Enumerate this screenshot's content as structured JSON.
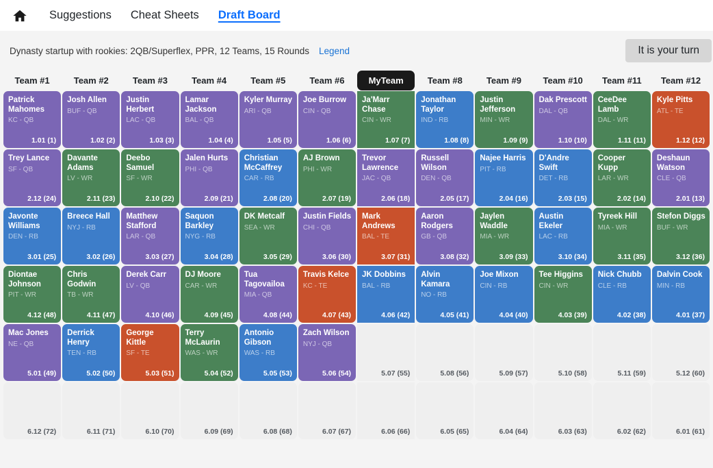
{
  "nav": {
    "home_icon": "home-icon",
    "items": [
      {
        "label": "Suggestions",
        "active": false
      },
      {
        "label": "Cheat Sheets",
        "active": false
      },
      {
        "label": "Draft Board",
        "active": true
      }
    ]
  },
  "subheader": {
    "league_description": "Dynasty startup with rookies: 2QB/Superflex, PPR, 12 Teams, 15 Rounds",
    "legend_label": "Legend",
    "turn_badge": "It is your turn"
  },
  "colors": {
    "QB": "#7b66b5",
    "RB": "#3d7dc9",
    "WR": "#4b8458",
    "TE": "#c9512c",
    "empty": "#efefef",
    "myteam_header": "#1a1a1a",
    "accent_link": "#0b6efd"
  },
  "board": {
    "my_team_index": 6,
    "columns": [
      "Team #1",
      "Team #2",
      "Team #3",
      "Team #4",
      "Team #5",
      "Team #6",
      "MyTeam",
      "Team #8",
      "Team #9",
      "Team #10",
      "Team #11",
      "Team #12"
    ],
    "rows": [
      [
        {
          "name": "Patrick Mahomes",
          "meta": "KC - QB",
          "pos": "QB",
          "pick": "1.01 (1)"
        },
        {
          "name": "Josh Allen",
          "meta": "BUF - QB",
          "pos": "QB",
          "pick": "1.02 (2)"
        },
        {
          "name": "Justin Herbert",
          "meta": "LAC - QB",
          "pos": "QB",
          "pick": "1.03 (3)"
        },
        {
          "name": "Lamar Jackson",
          "meta": "BAL - QB",
          "pos": "QB",
          "pick": "1.04 (4)"
        },
        {
          "name": "Kyler Murray",
          "meta": "ARI - QB",
          "pos": "QB",
          "pick": "1.05 (5)"
        },
        {
          "name": "Joe Burrow",
          "meta": "CIN - QB",
          "pos": "QB",
          "pick": "1.06 (6)"
        },
        {
          "name": "Ja'Marr Chase",
          "meta": "CIN - WR",
          "pos": "WR",
          "pick": "1.07 (7)"
        },
        {
          "name": "Jonathan Taylor",
          "meta": "IND - RB",
          "pos": "RB",
          "pick": "1.08 (8)"
        },
        {
          "name": "Justin Jefferson",
          "meta": "MIN - WR",
          "pos": "WR",
          "pick": "1.09 (9)"
        },
        {
          "name": "Dak Prescott",
          "meta": "DAL - QB",
          "pos": "QB",
          "pick": "1.10 (10)"
        },
        {
          "name": "CeeDee Lamb",
          "meta": "DAL - WR",
          "pos": "WR",
          "pick": "1.11 (11)"
        },
        {
          "name": "Kyle Pitts",
          "meta": "ATL - TE",
          "pos": "TE",
          "pick": "1.12 (12)"
        }
      ],
      [
        {
          "name": "Trey Lance",
          "meta": "SF - QB",
          "pos": "QB",
          "pick": "2.12 (24)"
        },
        {
          "name": "Davante Adams",
          "meta": "LV - WR",
          "pos": "WR",
          "pick": "2.11 (23)"
        },
        {
          "name": "Deebo Samuel",
          "meta": "SF - WR",
          "pos": "WR",
          "pick": "2.10 (22)"
        },
        {
          "name": "Jalen Hurts",
          "meta": "PHI - QB",
          "pos": "QB",
          "pick": "2.09 (21)"
        },
        {
          "name": "Christian McCaffrey",
          "meta": "CAR - RB",
          "pos": "RB",
          "pick": "2.08 (20)"
        },
        {
          "name": "AJ Brown",
          "meta": "PHI - WR",
          "pos": "WR",
          "pick": "2.07 (19)"
        },
        {
          "name": "Trevor Lawrence",
          "meta": "JAC - QB",
          "pos": "QB",
          "pick": "2.06 (18)"
        },
        {
          "name": "Russell Wilson",
          "meta": "DEN - QB",
          "pos": "QB",
          "pick": "2.05 (17)"
        },
        {
          "name": "Najee Harris",
          "meta": "PIT - RB",
          "pos": "RB",
          "pick": "2.04 (16)"
        },
        {
          "name": "D'Andre Swift",
          "meta": "DET - RB",
          "pos": "RB",
          "pick": "2.03 (15)"
        },
        {
          "name": "Cooper Kupp",
          "meta": "LAR - WR",
          "pos": "WR",
          "pick": "2.02 (14)"
        },
        {
          "name": "Deshaun Watson",
          "meta": "CLE - QB",
          "pos": "QB",
          "pick": "2.01 (13)"
        }
      ],
      [
        {
          "name": "Javonte Williams",
          "meta": "DEN - RB",
          "pos": "RB",
          "pick": "3.01 (25)"
        },
        {
          "name": "Breece Hall",
          "meta": "NYJ - RB",
          "pos": "RB",
          "pick": "3.02 (26)"
        },
        {
          "name": "Matthew Stafford",
          "meta": "LAR - QB",
          "pos": "QB",
          "pick": "3.03 (27)"
        },
        {
          "name": "Saquon Barkley",
          "meta": "NYG - RB",
          "pos": "RB",
          "pick": "3.04 (28)"
        },
        {
          "name": "DK Metcalf",
          "meta": "SEA - WR",
          "pos": "WR",
          "pick": "3.05 (29)"
        },
        {
          "name": "Justin Fields",
          "meta": "CHI - QB",
          "pos": "QB",
          "pick": "3.06 (30)"
        },
        {
          "name": "Mark Andrews",
          "meta": "BAL - TE",
          "pos": "TE",
          "pick": "3.07 (31)"
        },
        {
          "name": "Aaron Rodgers",
          "meta": "GB - QB",
          "pos": "QB",
          "pick": "3.08 (32)"
        },
        {
          "name": "Jaylen Waddle",
          "meta": "MIA - WR",
          "pos": "WR",
          "pick": "3.09 (33)"
        },
        {
          "name": "Austin Ekeler",
          "meta": "LAC - RB",
          "pos": "RB",
          "pick": "3.10 (34)"
        },
        {
          "name": "Tyreek Hill",
          "meta": "MIA - WR",
          "pos": "WR",
          "pick": "3.11 (35)"
        },
        {
          "name": "Stefon Diggs",
          "meta": "BUF - WR",
          "pos": "WR",
          "pick": "3.12 (36)"
        }
      ],
      [
        {
          "name": "Diontae Johnson",
          "meta": "PIT - WR",
          "pos": "WR",
          "pick": "4.12 (48)"
        },
        {
          "name": "Chris Godwin",
          "meta": "TB - WR",
          "pos": "WR",
          "pick": "4.11 (47)"
        },
        {
          "name": "Derek Carr",
          "meta": "LV - QB",
          "pos": "QB",
          "pick": "4.10 (46)"
        },
        {
          "name": "DJ Moore",
          "meta": "CAR - WR",
          "pos": "WR",
          "pick": "4.09 (45)"
        },
        {
          "name": "Tua Tagovailoa",
          "meta": "MIA - QB",
          "pos": "QB",
          "pick": "4.08 (44)"
        },
        {
          "name": "Travis Kelce",
          "meta": "KC - TE",
          "pos": "TE",
          "pick": "4.07 (43)"
        },
        {
          "name": "JK Dobbins",
          "meta": "BAL - RB",
          "pos": "RB",
          "pick": "4.06 (42)"
        },
        {
          "name": "Alvin Kamara",
          "meta": "NO - RB",
          "pos": "RB",
          "pick": "4.05 (41)"
        },
        {
          "name": "Joe Mixon",
          "meta": "CIN - RB",
          "pos": "RB",
          "pick": "4.04 (40)"
        },
        {
          "name": "Tee Higgins",
          "meta": "CIN - WR",
          "pos": "WR",
          "pick": "4.03 (39)"
        },
        {
          "name": "Nick Chubb",
          "meta": "CLE - RB",
          "pos": "RB",
          "pick": "4.02 (38)"
        },
        {
          "name": "Dalvin Cook",
          "meta": "MIN - RB",
          "pos": "RB",
          "pick": "4.01 (37)"
        }
      ],
      [
        {
          "name": "Mac Jones",
          "meta": "NE - QB",
          "pos": "QB",
          "pick": "5.01 (49)"
        },
        {
          "name": "Derrick Henry",
          "meta": "TEN - RB",
          "pos": "RB",
          "pick": "5.02 (50)"
        },
        {
          "name": "George Kittle",
          "meta": "SF - TE",
          "pos": "TE",
          "pick": "5.03 (51)"
        },
        {
          "name": "Terry McLaurin",
          "meta": "WAS - WR",
          "pos": "WR",
          "pick": "5.04 (52)"
        },
        {
          "name": "Antonio Gibson",
          "meta": "WAS - RB",
          "pos": "RB",
          "pick": "5.05 (53)"
        },
        {
          "name": "Zach Wilson",
          "meta": "NYJ - QB",
          "pos": "QB",
          "pick": "5.06 (54)"
        },
        {
          "name": "",
          "meta": "",
          "pos": "",
          "pick": "5.07 (55)"
        },
        {
          "name": "",
          "meta": "",
          "pos": "",
          "pick": "5.08 (56)"
        },
        {
          "name": "",
          "meta": "",
          "pos": "",
          "pick": "5.09 (57)"
        },
        {
          "name": "",
          "meta": "",
          "pos": "",
          "pick": "5.10 (58)"
        },
        {
          "name": "",
          "meta": "",
          "pos": "",
          "pick": "5.11 (59)"
        },
        {
          "name": "",
          "meta": "",
          "pos": "",
          "pick": "5.12 (60)"
        }
      ],
      [
        {
          "name": "",
          "meta": "",
          "pos": "",
          "pick": "6.12 (72)"
        },
        {
          "name": "",
          "meta": "",
          "pos": "",
          "pick": "6.11 (71)"
        },
        {
          "name": "",
          "meta": "",
          "pos": "",
          "pick": "6.10 (70)"
        },
        {
          "name": "",
          "meta": "",
          "pos": "",
          "pick": "6.09 (69)"
        },
        {
          "name": "",
          "meta": "",
          "pos": "",
          "pick": "6.08 (68)"
        },
        {
          "name": "",
          "meta": "",
          "pos": "",
          "pick": "6.07 (67)"
        },
        {
          "name": "",
          "meta": "",
          "pos": "",
          "pick": "6.06 (66)"
        },
        {
          "name": "",
          "meta": "",
          "pos": "",
          "pick": "6.05 (65)"
        },
        {
          "name": "",
          "meta": "",
          "pos": "",
          "pick": "6.04 (64)"
        },
        {
          "name": "",
          "meta": "",
          "pos": "",
          "pick": "6.03 (63)"
        },
        {
          "name": "",
          "meta": "",
          "pos": "",
          "pick": "6.02 (62)"
        },
        {
          "name": "",
          "meta": "",
          "pos": "",
          "pick": "6.01 (61)"
        }
      ]
    ]
  }
}
